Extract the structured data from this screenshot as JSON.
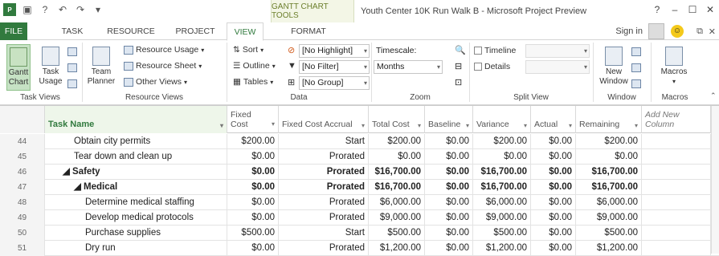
{
  "window": {
    "title": "Youth Center 10K Run Walk B - Microsoft Project Preview",
    "contextual_tab": "GANTT CHART TOOLS",
    "controls": [
      "?",
      "–",
      "☐",
      "✕"
    ]
  },
  "tabs": [
    "FILE",
    "TASK",
    "RESOURCE",
    "PROJECT",
    "VIEW",
    "FORMAT"
  ],
  "selected_tab": "VIEW",
  "account": {
    "sign_in": "Sign in"
  },
  "ribbon": {
    "task_views": {
      "label": "Task Views",
      "gantt": "Gantt",
      "gantt2": "Chart",
      "task_usage": "Task",
      "task_usage2": "Usage"
    },
    "resource_views": {
      "label": "Resource Views",
      "team_planner": "Team",
      "team_planner2": "Planner",
      "resource_usage": "Resource Usage",
      "resource_sheet": "Resource Sheet",
      "other_views": "Other Views"
    },
    "data": {
      "label": "Data",
      "sort": "Sort",
      "outline": "Outline",
      "tables": "Tables",
      "highlight": "[No Highlight]",
      "filter": "[No Filter]",
      "group": "[No Group]"
    },
    "zoom": {
      "label": "Zoom",
      "timescale_label": "Timescale:",
      "timescale_value": "Months"
    },
    "split_view": {
      "label": "Split View",
      "timeline": "Timeline",
      "details": "Details"
    },
    "window": {
      "label": "Window",
      "new_window": "New",
      "new_window2": "Window"
    },
    "macros": {
      "label": "Macros",
      "macros": "Macros"
    }
  },
  "columns": [
    "Task Name",
    "Fixed Cost",
    "Fixed Cost Accrual",
    "Total Cost",
    "Baseline",
    "Variance",
    "Actual",
    "Remaining",
    "Add New Column"
  ],
  "fixed_cost_header": [
    "Fixed",
    "Cost"
  ],
  "rows": [
    {
      "id": "44",
      "name": "Obtain city permits",
      "fixed": "$200.00",
      "accrual": "Start",
      "total": "$200.00",
      "baseline": "$0.00",
      "variance": "$200.00",
      "actual": "$0.00",
      "remaining": "$200.00"
    },
    {
      "id": "45",
      "name": "Tear down and clean up",
      "fixed": "$0.00",
      "accrual": "Prorated",
      "total": "$0.00",
      "baseline": "$0.00",
      "variance": "$0.00",
      "actual": "$0.00",
      "remaining": "$0.00"
    },
    {
      "id": "46",
      "name": "◢ Safety",
      "fixed": "$0.00",
      "accrual": "Prorated",
      "total": "$16,700.00",
      "baseline": "$0.00",
      "variance": "$16,700.00",
      "actual": "$0.00",
      "remaining": "$16,700.00"
    },
    {
      "id": "47",
      "name": "◢ Medical",
      "fixed": "$0.00",
      "accrual": "Prorated",
      "total": "$16,700.00",
      "baseline": "$0.00",
      "variance": "$16,700.00",
      "actual": "$0.00",
      "remaining": "$16,700.00"
    },
    {
      "id": "48",
      "name": "Determine medical staffing",
      "fixed": "$0.00",
      "accrual": "Prorated",
      "total": "$6,000.00",
      "baseline": "$0.00",
      "variance": "$6,000.00",
      "actual": "$0.00",
      "remaining": "$6,000.00"
    },
    {
      "id": "49",
      "name": "Develop medical protocols",
      "fixed": "$0.00",
      "accrual": "Prorated",
      "total": "$9,000.00",
      "baseline": "$0.00",
      "variance": "$9,000.00",
      "actual": "$0.00",
      "remaining": "$9,000.00"
    },
    {
      "id": "50",
      "name": "Purchase supplies",
      "fixed": "$500.00",
      "accrual": "Start",
      "total": "$500.00",
      "baseline": "$0.00",
      "variance": "$500.00",
      "actual": "$0.00",
      "remaining": "$500.00"
    },
    {
      "id": "51",
      "name": "Dry run",
      "fixed": "$0.00",
      "accrual": "Prorated",
      "total": "$1,200.00",
      "baseline": "$0.00",
      "variance": "$1,200.00",
      "actual": "$0.00",
      "remaining": "$1,200.00"
    }
  ],
  "colors": {
    "accent": "#317a3e",
    "context_tab": "#6c7f2c"
  }
}
